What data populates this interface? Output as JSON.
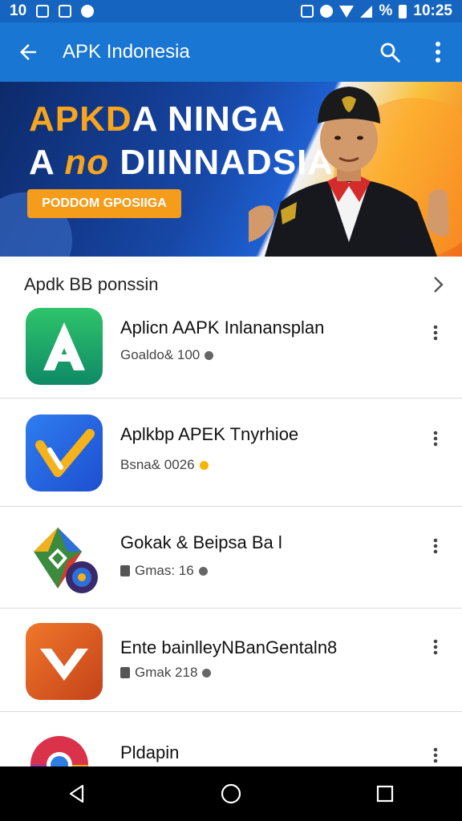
{
  "status_bar": {
    "left_time": "10",
    "percent": "%",
    "time": "10:25"
  },
  "app_bar": {
    "title": "APK Indonesia",
    "back_icon": "arrow-left-icon",
    "search_icon": "search-icon",
    "menu_icon": "more-vertical-icon"
  },
  "banner": {
    "line1_orange": "APKD",
    "line1_white": "A NINGA",
    "line2_a": "A ",
    "line2_orange": "no",
    "line2_b": " DIINNADSIA",
    "cta": "PODDOM GPOSIIGA"
  },
  "section": {
    "title": "Apdk BB ponssin",
    "chevron_icon": "chevron-right-icon"
  },
  "apps": [
    {
      "name": "Aplicn AAPK Inlanansplan",
      "meta": "Goaldo& 100",
      "dot_color": "#666666",
      "icon": "green-a-app-icon"
    },
    {
      "name": "Aplkbp APEK Tnyrhioe",
      "meta": "Bsna& 0026",
      "dot_color": "#f5b400",
      "icon": "blue-checkmark-app-icon"
    },
    {
      "name": "Gokak & Beipsa Ba l",
      "meta": "Gmas: 16",
      "dot_color": "#666666",
      "icon": "colorful-diamond-app-icon"
    },
    {
      "name": "Ente bainlleyNBanGentaln8",
      "meta": "Gmak 218",
      "dot_color": "#666666",
      "icon": "orange-v-app-icon"
    },
    {
      "name": "Pldapin",
      "meta": "",
      "dot_color": "#666666",
      "icon": "chrome-style-app-icon"
    }
  ],
  "colors": {
    "status_bar": "#1565c0",
    "app_bar": "#1976d2",
    "accent_orange": "#f59c1a"
  }
}
